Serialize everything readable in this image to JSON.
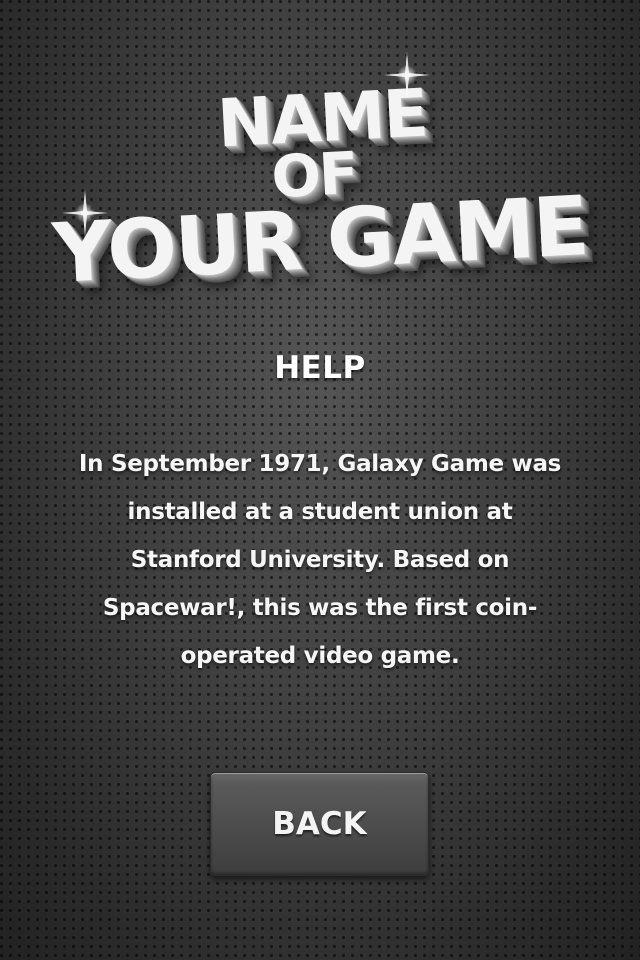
{
  "logo": {
    "line1": "NAME",
    "line2": "OF",
    "line3": "YOUR GAME",
    "sparkle_icon": "sparkle-icon"
  },
  "help": {
    "title": "HELP",
    "body": "In September 1971, Galaxy Game was installed at a student union at Stanford University. Based on Spacewar!, this was the first coin-operated video game."
  },
  "back_button": {
    "label": "BACK"
  },
  "colors": {
    "background": "#333333",
    "text": "#ffffff",
    "button": "#4c4c4c"
  }
}
